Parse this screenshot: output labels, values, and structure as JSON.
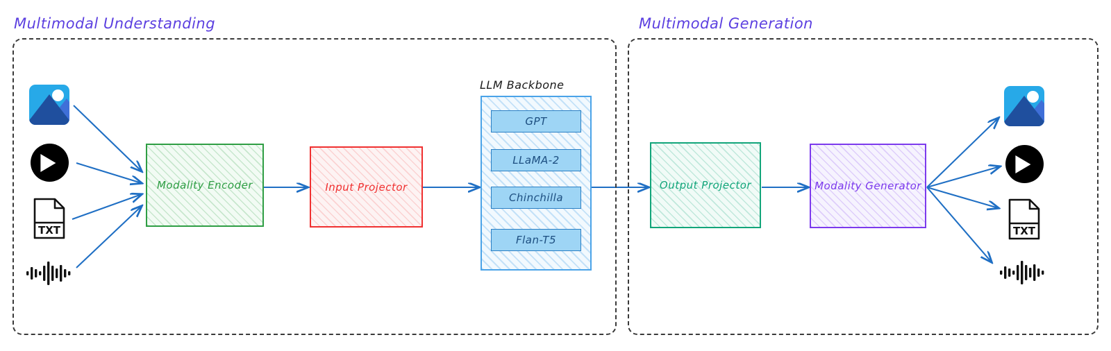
{
  "groups": [
    {
      "id": "understanding",
      "title": "Multimodal Understanding"
    },
    {
      "id": "generation",
      "title": "Multimodal Generation"
    }
  ],
  "boxes": {
    "modality_encoder": {
      "label": "Modality Encoder",
      "color": "#2f9e44"
    },
    "input_projector": {
      "label": "Input Projector",
      "color": "#f03030"
    },
    "output_projector": {
      "label": "Output Projector",
      "color": "#12a57a"
    },
    "modality_generator": {
      "label": "Modality Generator",
      "color": "#7c3aed"
    }
  },
  "llm_backbone": {
    "title": "LLM Backbone",
    "color": "#4aa3e8",
    "items": [
      {
        "label": "GPT"
      },
      {
        "label": "LLaMA-2"
      },
      {
        "label": "Chinchilla"
      },
      {
        "label": "Flan-T5"
      }
    ]
  },
  "input_modalities": [
    {
      "icon": "image-icon",
      "name": "image"
    },
    {
      "icon": "video-icon",
      "name": "video"
    },
    {
      "icon": "text-file-icon",
      "name": "text",
      "label": "TXT"
    },
    {
      "icon": "audio-waveform-icon",
      "name": "audio"
    }
  ],
  "output_modalities": [
    {
      "icon": "image-icon",
      "name": "image"
    },
    {
      "icon": "video-icon",
      "name": "video"
    },
    {
      "icon": "text-file-icon",
      "name": "text",
      "label": "TXT"
    },
    {
      "icon": "audio-waveform-icon",
      "name": "audio"
    }
  ],
  "colors": {
    "arrow": "#1f6fc4",
    "group_border": "#3a3a3a",
    "title": "#5b3fe0",
    "llm_item_fill": "#9ed5f5",
    "llm_item_border": "#2a7fc4"
  }
}
